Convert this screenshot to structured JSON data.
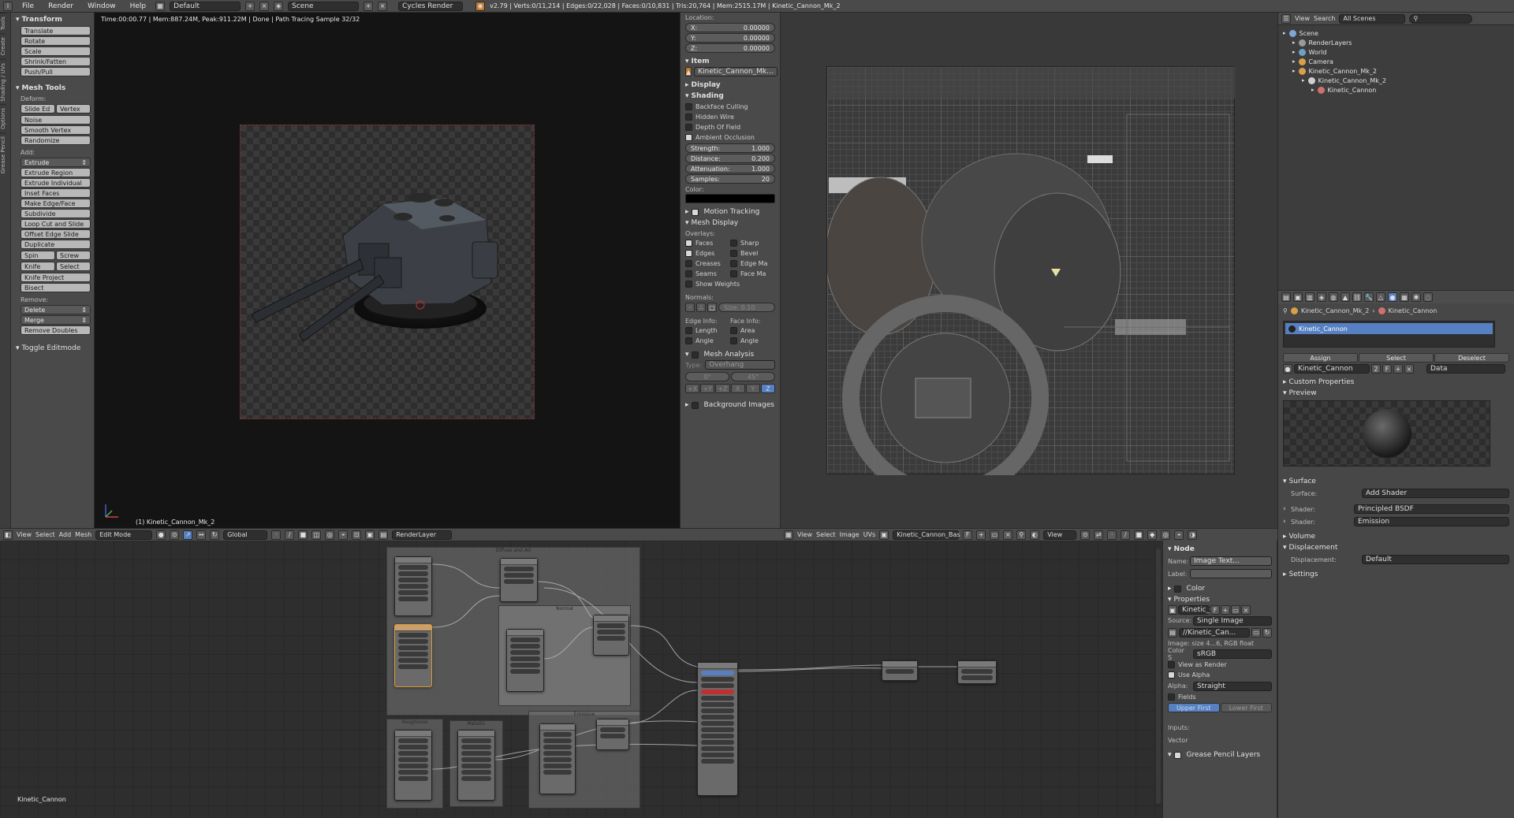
{
  "topbar": {
    "menus": [
      "File",
      "Render",
      "Window",
      "Help"
    ],
    "layout": "Default",
    "scene": "Scene",
    "engine": "Cycles Render",
    "stats": "v2.79 | Verts:0/11,214 | Edges:0/22,028 | Faces:0/10,831 | Tris:20,764 | Mem:2515.17M | Kinetic_Cannon_Mk_2"
  },
  "vtabs": [
    "Tools",
    "Create",
    "Shading / UVs",
    "Options",
    "Grease Pencil"
  ],
  "toolshelf": {
    "transform_header": "Transform",
    "transform_buttons": [
      "Translate",
      "Rotate",
      "Scale",
      "Shrink/Fatten",
      "Push/Pull"
    ],
    "meshtools_header": "Mesh Tools",
    "deform_label": "Deform:",
    "slide_edge": "Slide Ed",
    "vertex": "Vertex",
    "deform_buttons": [
      "Noise",
      "Smooth Vertex",
      "Randomize"
    ],
    "add_label": "Add:",
    "extrude": "Extrude",
    "add_buttons": [
      "Extrude Region",
      "Extrude Individual",
      "Inset Faces",
      "Make Edge/Face",
      "Subdivide",
      "Loop Cut and Slide",
      "Offset Edge Slide",
      "Duplicate"
    ],
    "spin": "Spin",
    "screw": "Screw",
    "knife": "Knife",
    "select": "Select",
    "knife_project": "Knife Project",
    "bisect": "Bisect",
    "remove_label": "Remove:",
    "delete": "Delete",
    "merge": "Merge",
    "remove_doubles": "Remove Doubles",
    "toggle_editmode": "Toggle Editmode"
  },
  "viewport": {
    "render_status": "Time:00:00.77 | Mem:887.24M, Peak:911.22M | Done | Path Tracing Sample 32/32",
    "object_label": "(1) Kinetic_Cannon_Mk_2"
  },
  "viewport_header": {
    "items": [
      "View",
      "Select",
      "Add",
      "Mesh"
    ],
    "mode": "Edit Mode",
    "orientation": "Global",
    "render_layer": "RenderLayer"
  },
  "npanel": {
    "location_label": "Location:",
    "x": {
      "label": "X:",
      "value": "0.00000"
    },
    "y": {
      "label": "Y:",
      "value": "0.00000"
    },
    "z": {
      "label": "Z:",
      "value": "0.00000"
    },
    "item_header": "Item",
    "item_name": "Kinetic_Cannon_Mk...",
    "display_header": "Display",
    "shading_header": "Shading",
    "backface": "Backface Culling",
    "hidden_wire": "Hidden Wire",
    "dof": "Depth Of Field",
    "ao": "Ambient Occlusion",
    "strength": {
      "label": "Strength:",
      "value": "1.000"
    },
    "distance": {
      "label": "Distance:",
      "value": "0.200"
    },
    "attenuation": {
      "label": "Attenuation:",
      "value": "1.000"
    },
    "samples": {
      "label": "Samples:",
      "value": "20"
    },
    "color_label": "Color:",
    "motion_tracking": "Motion Tracking",
    "mesh_display": "Mesh Display",
    "overlays_label": "Overlays:",
    "faces": "Faces",
    "sharp": "Sharp",
    "edges": "Edges",
    "bevel": "Bevel",
    "creases": "Creases",
    "edge_marks": "Edge Ma",
    "seams": "Seams",
    "face_marks": "Face Ma",
    "show_weights": "Show Weights",
    "normals_label": "Normals:",
    "normals_size": "Size: 0.10",
    "edge_info": "Edge Info:",
    "face_info": "Face Info:",
    "length": "Length",
    "area": "Area",
    "angle1": "Angle",
    "angle2": "Angle",
    "mesh_analysis": "Mesh Analysis",
    "type_label": "Type:",
    "type_value": "Overhang",
    "range_min": "0°",
    "range_max": "45°",
    "axis_buttons": [
      "+X",
      "+Y",
      "+Z",
      "X",
      "Y",
      "Z"
    ],
    "background_images": "Background Images"
  },
  "uv_header": {
    "items": [
      "View",
      "Select",
      "Image",
      "UVs"
    ],
    "image_name": "Kinetic_Cannon_Bas",
    "view": "View"
  },
  "outliner": {
    "view": "View",
    "search": "Search",
    "scenes": "All Scenes",
    "tree": [
      {
        "label": "Scene",
        "indent": 0,
        "color": "#7ea7d8"
      },
      {
        "label": "RenderLayers",
        "indent": 1,
        "color": "#9a9a9a"
      },
      {
        "label": "World",
        "indent": 1,
        "color": "#6fa0c8"
      },
      {
        "label": "Camera",
        "indent": 1,
        "color": "#d9a04a"
      },
      {
        "label": "Kinetic_Cannon_Mk_2",
        "indent": 1,
        "color": "#d9a04a"
      },
      {
        "label": "Kinetic_Cannon_Mk_2",
        "indent": 2,
        "color": "#cfcfcf"
      },
      {
        "label": "Kinetic_Cannon",
        "indent": 3,
        "color": "#d07070"
      }
    ]
  },
  "properties": {
    "breadcrumb_obj": "Kinetic_Cannon_Mk_2",
    "breadcrumb_mat": "Kinetic_Cannon",
    "slot_name": "Kinetic_Cannon",
    "assign": "Assign",
    "select": "Select",
    "deselect": "Deselect",
    "material_name": "Kinetic_Cannon",
    "users": "2",
    "fake": "F",
    "data": "Data",
    "custom_props": "Custom Properties",
    "preview": "Preview",
    "surface": "Surface",
    "surface_label": "Surface:",
    "surface_value": "Add Shader",
    "shader1_label": "Shader:",
    "shader1_value": "Principled BSDF",
    "shader2_label": "Shader:",
    "shader2_value": "Emission",
    "volume": "Volume",
    "displacement_header": "Displacement",
    "displacement_label": "Displacement:",
    "displacement_value": "Default",
    "settings": "Settings"
  },
  "node_sidebar": {
    "node_header": "Node",
    "name_label": "Name:",
    "name_value": "Image Text...",
    "label_label": "Label:",
    "color_header": "Color",
    "properties_header": "Properties",
    "image_name": "Kinetic_C",
    "fake": "F",
    "source_label": "Source:",
    "source_value": "Single Image",
    "filepath": "//Kinetic_Can...",
    "image_info": "Image: size 4...6, RGB float",
    "colorspace_label": "Color S",
    "colorspace_value": "sRGB",
    "view_as_render": "View as Render",
    "use_alpha": "Use Alpha",
    "alpha_label": "Alpha:",
    "alpha_value": "Straight",
    "fields": "Fields",
    "upper_first": "Upper First",
    "lower_first": "Lower First",
    "inputs": "Inputs:",
    "vector": "Vector",
    "grease_pencil": "Grease Pencil Layers"
  },
  "node_editor": {
    "material_label": "Kinetic_Cannon",
    "frame_labels": [
      "Diffuse and AO",
      "Normal",
      "Roughness",
      "Metallic",
      "Emissive"
    ]
  }
}
